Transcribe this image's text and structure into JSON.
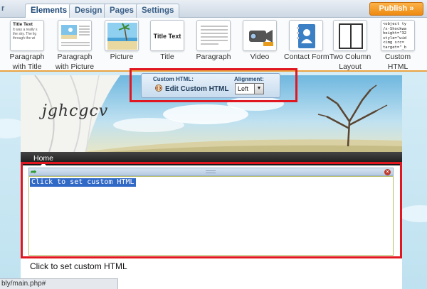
{
  "toolbar": {
    "left_fragment": "r",
    "tabs": [
      {
        "label": "Elements",
        "active": true
      },
      {
        "label": "Design",
        "active": false
      },
      {
        "label": "Pages",
        "active": false
      },
      {
        "label": "Settings",
        "active": false
      }
    ],
    "publish_label": "Publish »"
  },
  "elements": [
    {
      "label_1": "Paragraph",
      "label_2": "with Title",
      "thumb_title": "Title Text",
      "thumb_text": "It was a really s the sky.  The lig through the wi"
    },
    {
      "label_1": "Paragraph",
      "label_2": "with Picture"
    },
    {
      "label_1": "Picture",
      "label_2": ""
    },
    {
      "label_1": "Title",
      "label_2": "",
      "thumb_title": "Title Text"
    },
    {
      "label_1": "Paragraph",
      "label_2": ""
    },
    {
      "label_1": "Video",
      "label_2": ""
    },
    {
      "label_1": "Contact Form",
      "label_2": ""
    },
    {
      "label_1": "Two Column",
      "label_2": "Layout"
    },
    {
      "label_1": "Custom",
      "label_2": "HTML",
      "thumb_code": "<object ty /x-Shockwa height=\"32 style=\"wid <img src= target=\"_b"
    }
  ],
  "site": {
    "title": "jghcgcv",
    "nav_home": "Home"
  },
  "popup": {
    "custom_label": "Custom HTML:",
    "edit_label": "Edit Custom HTML",
    "alignment_label": "Alignment:",
    "alignment_value": "Left"
  },
  "block": {
    "placeholder_code": "Click to set custom HTML",
    "below_text": "Click to set custom HTML"
  },
  "status": {
    "url": "bly/main.php#"
  },
  "colors": {
    "publish": "#f29a1f",
    "highlight_red": "#e01720",
    "selection_blue": "#3169c6"
  }
}
